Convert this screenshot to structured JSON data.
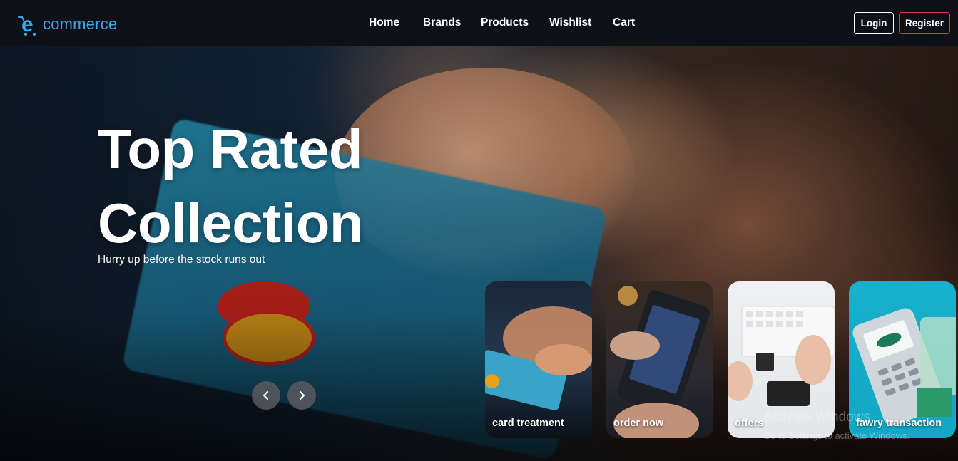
{
  "brand": {
    "name": "commerce",
    "logo_icon": "cart-e-icon",
    "color": "#3aa8e8"
  },
  "nav": {
    "links": [
      "Home",
      "Brands",
      "Products",
      "Wishlist",
      "Cart"
    ],
    "login_label": "Login",
    "register_label": "Register"
  },
  "hero": {
    "title_line1": "Top Rated",
    "title_line2": "Collection",
    "subtitle": "Hurry up before the stock runs out",
    "prev_icon": "chevron-left-icon",
    "next_icon": "chevron-right-icon"
  },
  "slides": [
    {
      "label": "card treatment"
    },
    {
      "label": "order now"
    },
    {
      "label": "offers"
    },
    {
      "label": "fawry transaction"
    }
  ],
  "watermark": {
    "title": "Activate Windows",
    "subtitle": "Go to Settings to activate Windows."
  },
  "colors": {
    "accent": "#3aa8e8",
    "register_border": "#d83a4a",
    "nav_bg": "#0d1117"
  }
}
